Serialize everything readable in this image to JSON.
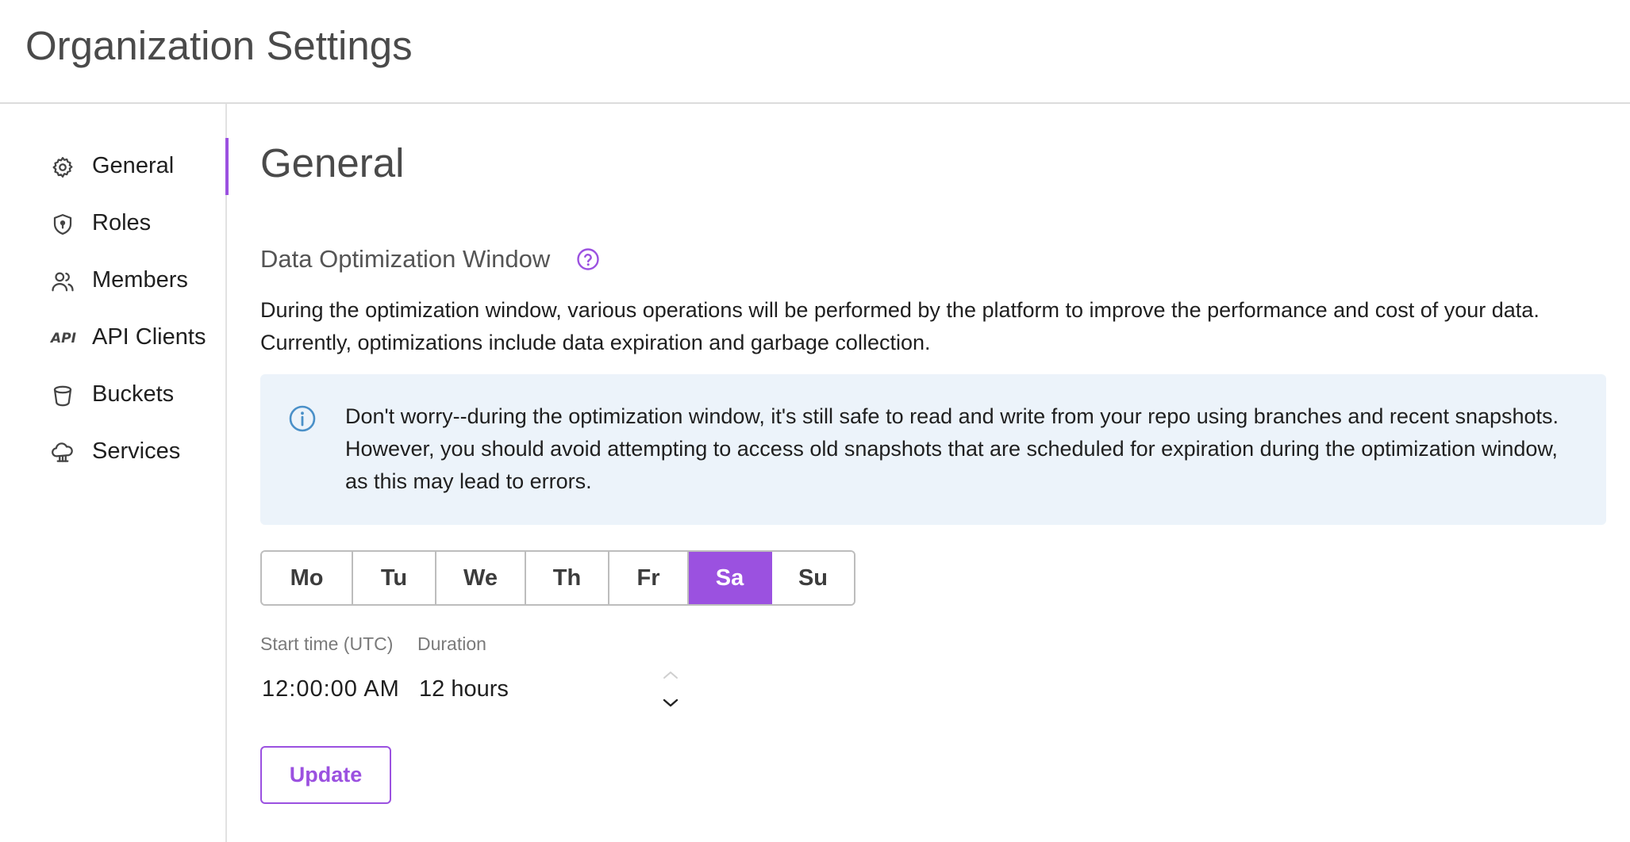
{
  "header": {
    "title": "Organization Settings"
  },
  "sidebar": {
    "items": [
      {
        "label": "General",
        "icon": "gear-icon",
        "active": true
      },
      {
        "label": "Roles",
        "icon": "shield-icon",
        "active": false
      },
      {
        "label": "Members",
        "icon": "users-icon",
        "active": false
      },
      {
        "label": "API Clients",
        "icon": "api-icon",
        "active": false
      },
      {
        "label": "Buckets",
        "icon": "bucket-icon",
        "active": false
      },
      {
        "label": "Services",
        "icon": "cloud-service-icon",
        "active": false
      }
    ],
    "api_glyph": "API"
  },
  "main": {
    "title": "General",
    "section": {
      "title": "Data Optimization Window",
      "description": "During the optimization window, various operations will be performed by the platform to improve the performance and cost of your data. Currently, optimizations include data expiration and garbage collection.",
      "info": "Don't worry--during the optimization window, it's still safe to read and write from your repo using branches and recent snapshots. However, you should avoid attempting to access old snapshots that are scheduled for expiration during the optimization window, as this may lead to errors.",
      "days": [
        "Mo",
        "Tu",
        "We",
        "Th",
        "Fr",
        "Sa",
        "Su"
      ],
      "selected_day": "Sa",
      "start_time_label": "Start time (UTC)",
      "start_time_value": "12:00:00  AM",
      "duration_label": "Duration",
      "duration_value": "12 hours",
      "update_label": "Update"
    }
  },
  "colors": {
    "accent": "#9b51e0",
    "info_bg": "#ecf3fa",
    "info_icon": "#4a90c8"
  }
}
